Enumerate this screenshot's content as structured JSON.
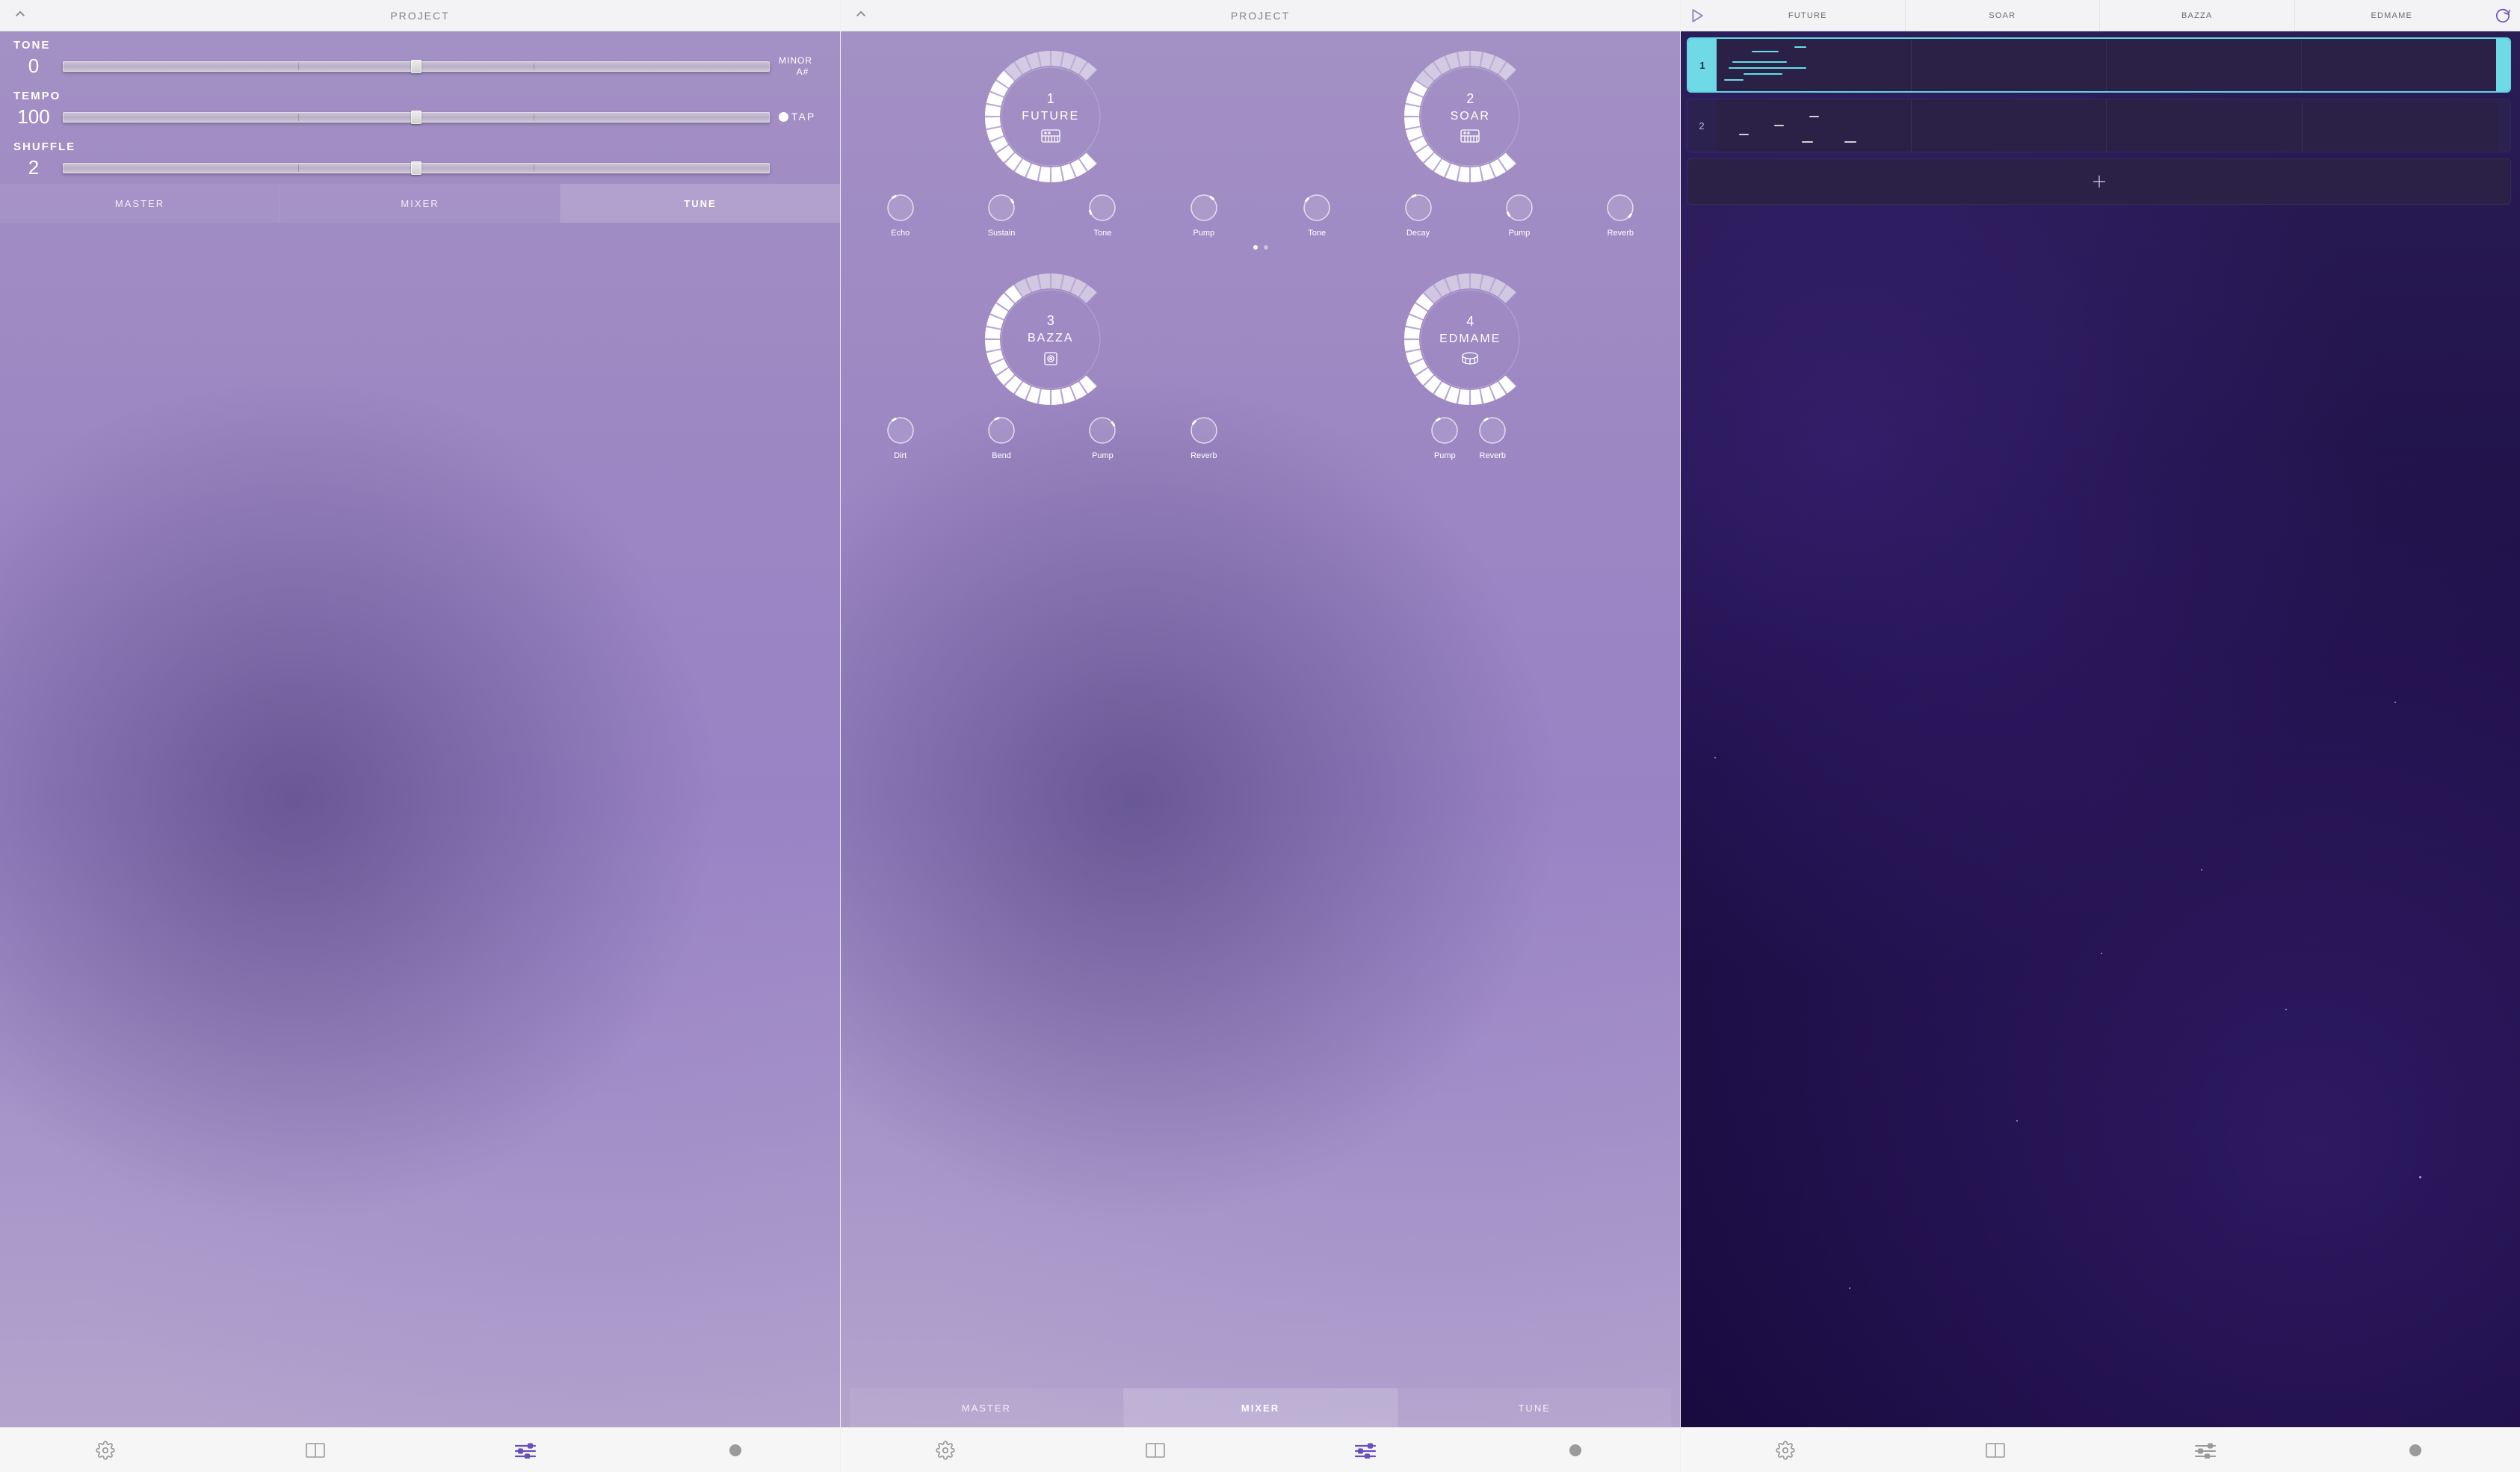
{
  "pane1": {
    "title": "PROJECT",
    "tone": {
      "label": "TONE",
      "value": "0",
      "scale": "MINOR",
      "root": "A#"
    },
    "tempo": {
      "label": "TEMPO",
      "value": "100",
      "tap": "TAP"
    },
    "shuffle": {
      "label": "SHUFFLE",
      "value": "2"
    },
    "modes": {
      "master": "MASTER",
      "mixer": "MIXER",
      "tune": "TUNE",
      "active": "tune"
    }
  },
  "pane2": {
    "title": "PROJECT",
    "dials": [
      {
        "num": "1",
        "name": "FUTURE",
        "icon": "synth-icon"
      },
      {
        "num": "2",
        "name": "SOAR",
        "icon": "synth-icon"
      },
      {
        "num": "3",
        "name": "BAZZA",
        "icon": "bass-icon"
      },
      {
        "num": "4",
        "name": "EDMAME",
        "icon": "drum-icon"
      }
    ],
    "knobs_top_left": [
      "Echo",
      "Sustain",
      "Tone",
      "Pump"
    ],
    "knobs_top_right": [
      "Tone",
      "Decay",
      "Pump",
      "Reverb"
    ],
    "knobs_bot_left": [
      "Dirt",
      "Bend",
      "Pump",
      "Reverb"
    ],
    "knobs_bot_right": [
      "Pump",
      "Reverb"
    ],
    "modes": {
      "master": "MASTER",
      "mixer": "MIXER",
      "tune": "TUNE",
      "active": "mixer"
    }
  },
  "pane3": {
    "tabs": [
      "FUTURE",
      "SOAR",
      "BAZZA",
      "EDMAME"
    ],
    "tracks": [
      {
        "num": "1",
        "selected": true
      },
      {
        "num": "2",
        "selected": false
      }
    ],
    "add_label": "+"
  },
  "toolbar": {
    "settings": "settings-icon",
    "library": "library-icon",
    "sliders": "sliders-icon",
    "record": "record-icon"
  }
}
